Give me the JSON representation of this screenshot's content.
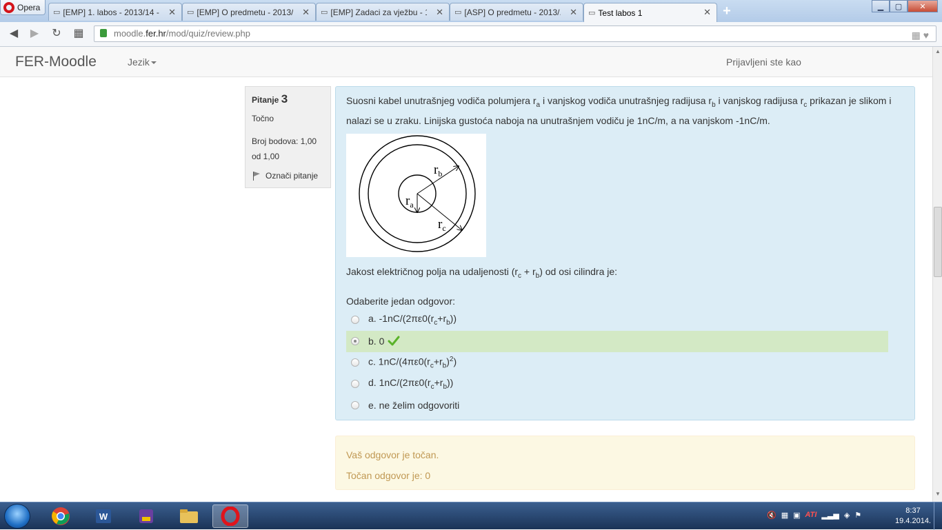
{
  "browser": {
    "opera_label": "Opera",
    "tabs": [
      {
        "label": "[EMP] 1. labos - 2013/14 - ..."
      },
      {
        "label": "[EMP] O predmetu - 2013/..."
      },
      {
        "label": "[EMP] Zadaci za vježbu - 1..."
      },
      {
        "label": "[ASP] O predmetu - 2013/..."
      },
      {
        "label": "Test labos 1"
      }
    ],
    "url_prefix": "moodle.",
    "url_domain": "fer.hr",
    "url_path": "/mod/quiz/review.php"
  },
  "header": {
    "brand": "FER-Moodle",
    "language_menu": "Jezik",
    "logged_in_label": "Prijavljeni ste kao"
  },
  "question_info": {
    "label": "Pitanje",
    "number": "3",
    "state": "Točno",
    "grade_line1": "Broj bodova: 1,00",
    "grade_line2": "od 1,00",
    "flag_label": "Označi pitanje"
  },
  "question": {
    "text_intro": "Suosni kabel unutrašnjeg vodiča polumjera r",
    "sub_a": "a",
    "text_mid1": " i vanjskog vodiča unutrašnjeg radijusa r",
    "sub_b": "b",
    "text_mid2": " i vanjskog radijusa r",
    "sub_c": "c",
    "text_end": " prikazan je slikom i nalazi se u zraku. Linijska gustoća naboja na unutrašnjem vodiču je 1nC/m, a na vanjskom -1nC/m.",
    "figure_labels": {
      "ra": "r",
      "ra_sub": "a",
      "rb": "r",
      "rb_sub": "b",
      "rc": "r",
      "rc_sub": "c"
    },
    "prompt_start": "Jakost električnog polja na udaljenosti (r",
    "prompt_sub_c": "c",
    "prompt_plus": " + r",
    "prompt_sub_b": "b",
    "prompt_end": ") od osi cilindra je:",
    "choose_label": "Odaberite jedan odgovor:",
    "answers": [
      {
        "prefix": "a. -1nC/(2πε0(r",
        "s1": "c",
        "mid": "+r",
        "s2": "b",
        "suffix": "))",
        "sup": ""
      },
      {
        "prefix": "b. 0",
        "s1": "",
        "mid": "",
        "s2": "",
        "suffix": "",
        "sup": ""
      },
      {
        "prefix": "c. 1nC/(4πε0(r",
        "s1": "c",
        "mid": "+r",
        "s2": "b",
        "suffix": ")",
        "sup": "2",
        "end": ")"
      },
      {
        "prefix": "d. 1nC/(2πε0(r",
        "s1": "c",
        "mid": "+r",
        "s2": "b",
        "suffix": "))",
        "sup": ""
      },
      {
        "prefix": "e. ne želim odgovoriti",
        "s1": "",
        "mid": "",
        "s2": "",
        "suffix": "",
        "sup": ""
      }
    ],
    "selected_index": 1
  },
  "feedback": {
    "line1": "Vaš odgovor je točan.",
    "line2": "Točan odgovor je: 0"
  },
  "taskbar": {
    "clock_time": "8:37",
    "clock_date": "19.4.2014.",
    "tray_ati": "ATI"
  },
  "colors": {
    "question_bg": "#dcedf6",
    "correct_bg": "#d3e9c5",
    "feedback_bg": "#fcf8e3",
    "feedback_text": "#c09853",
    "check_green": "#5ab22a"
  }
}
